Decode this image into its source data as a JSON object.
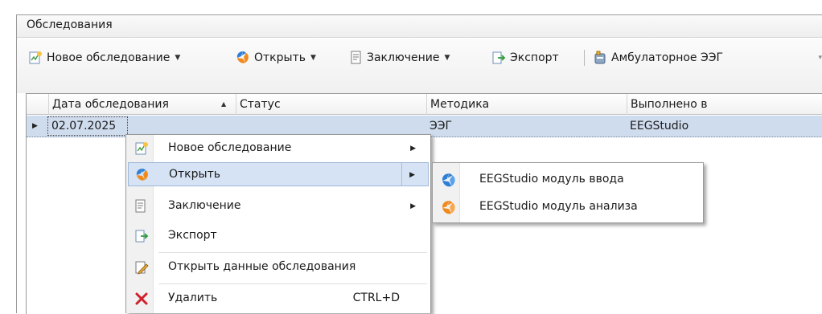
{
  "panel": {
    "title": "Обследования"
  },
  "toolbar": {
    "new_exam": {
      "label": "Новое обследование",
      "icon": "new-document-icon"
    },
    "open": {
      "label": "Открыть",
      "icon": "eegstudio-logo-icon"
    },
    "conclusion": {
      "label": "Заключение",
      "icon": "document-icon"
    },
    "export": {
      "label": "Экспорт",
      "icon": "export-icon"
    },
    "ambulatory": {
      "label": "Амбулаторное ЭЭГ",
      "icon": "device-icon"
    }
  },
  "grid": {
    "columns": [
      "Дата обследования",
      "Статус",
      "Методика",
      "Выполнено в"
    ],
    "sort_column": "Дата обследования",
    "rows": [
      {
        "date": "02.07.2025",
        "status": "",
        "method": "ЭЭГ",
        "performed_in": "EEGStudio"
      }
    ]
  },
  "context_menu": {
    "items": [
      {
        "label": "Новое обследование",
        "icon": "new-document-icon",
        "has_submenu": true
      },
      {
        "label": "Открыть",
        "icon": "eegstudio-logo-icon",
        "has_submenu": true,
        "active": true
      },
      {
        "label": "Заключение",
        "icon": "document-icon",
        "has_submenu": true
      },
      {
        "label": "Экспорт",
        "icon": "export-icon",
        "has_submenu": false
      },
      {
        "label": "Открыть данные обследования",
        "icon": "edit-icon",
        "has_submenu": false
      },
      {
        "label": "Удалить",
        "icon": "delete-icon",
        "shortcut": "CTRL+D"
      }
    ]
  },
  "submenu": {
    "items": [
      {
        "label": "EEGStudio модуль ввода",
        "icon": "eegstudio-blue-icon"
      },
      {
        "label": "EEGStudio модуль анализа",
        "icon": "eegstudio-orange-icon"
      }
    ]
  },
  "colors": {
    "selection": "#cfdcee",
    "menu_highlight": "#d6e3f4",
    "logo_blue": "#2f7fd6",
    "logo_orange": "#f08a1c",
    "delete_red": "#d0212a"
  }
}
